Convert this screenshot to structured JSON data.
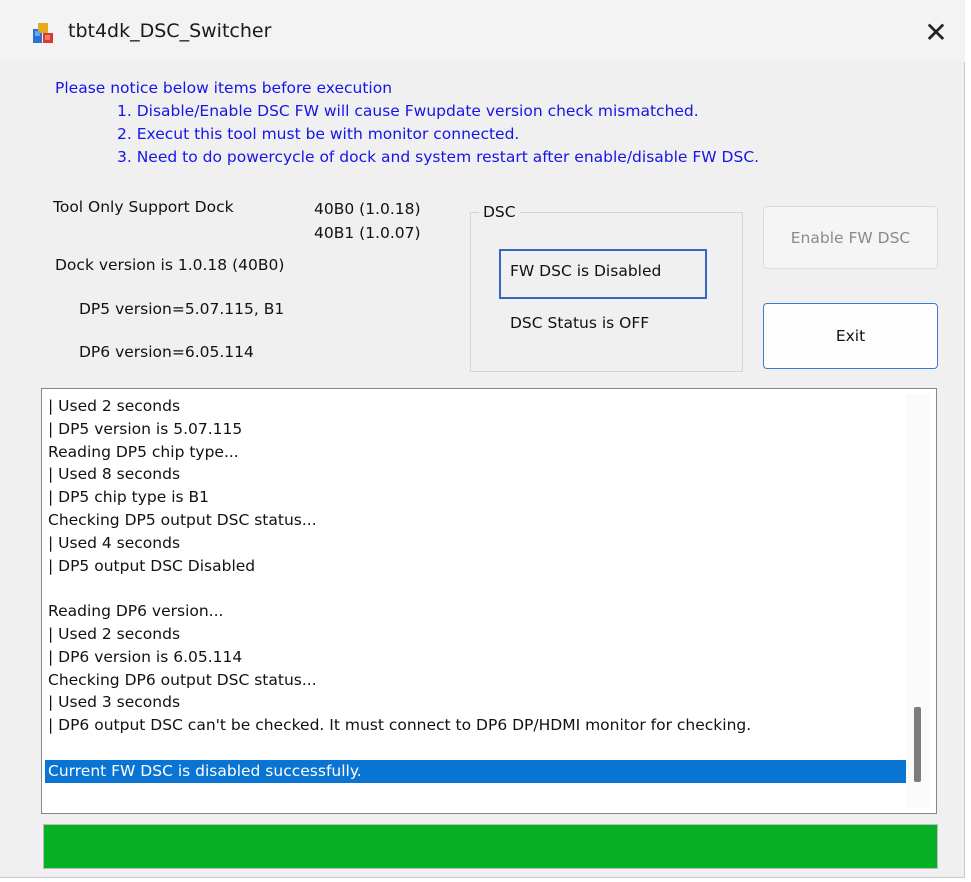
{
  "window": {
    "title": "tbt4dk_DSC_Switcher",
    "app_icon": "app-icon",
    "close_symbol": "✕"
  },
  "notice": {
    "heading": "Please notice below items before execution",
    "items": [
      "1. Disable/Enable DSC FW will cause Fwupdate version check mismatched.",
      "2. Execut this tool must be with monitor connected.",
      "3. Need to do powercycle of dock and system restart after enable/disable FW DSC."
    ],
    "color": "#1515e8"
  },
  "info": {
    "support_label": "Tool Only Support Dock",
    "support_versions": [
      "40B0 (1.0.18)",
      "40B1 (1.0.07)"
    ],
    "dock_version": "Dock version is 1.0.18 (40B0)",
    "dp5_version": "DP5 version=5.07.115, B1",
    "dp6_version": "DP6 version=6.05.114"
  },
  "dsc": {
    "group_title": "DSC",
    "fw_status": "FW DSC is Disabled",
    "dsc_status": "DSC Status is OFF"
  },
  "buttons": {
    "enable_fw": "Enable FW DSC",
    "exit": "Exit"
  },
  "log": {
    "lines": [
      "|   Used 2 seconds",
      "|   DP5 version is 5.07.115",
      "Reading DP5 chip type...",
      "|   Used 8 seconds",
      "|   DP5 chip type is B1",
      "Checking DP5 output DSC status...",
      "|   Used 4 seconds",
      "|   DP5 output DSC Disabled",
      "",
      "Reading DP6 version...",
      "|   Used 2 seconds",
      "|   DP6 version is 6.05.114",
      "Checking DP6 output DSC status...",
      "|   Used 3 seconds",
      "|   DP6 output DSC can't be checked. It must connect to DP6 DP/HDMI monitor for checking.",
      "",
      "Current FW DSC is disabled successfully."
    ],
    "selected_index": 16,
    "selection_color": "#0a74d2"
  },
  "progress": {
    "value": 1.0,
    "color": "#06b025"
  }
}
